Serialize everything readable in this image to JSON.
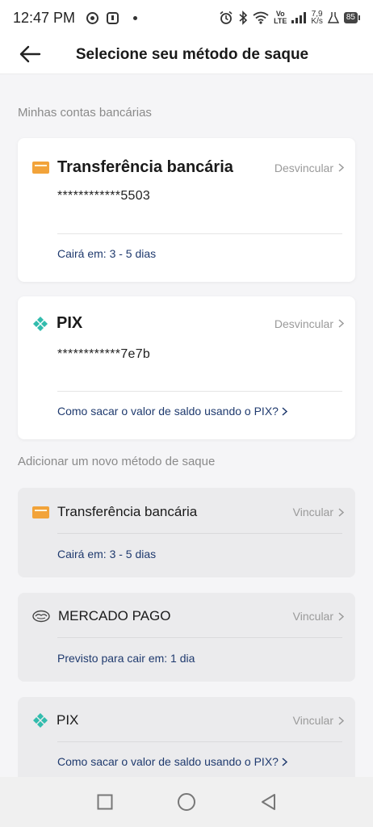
{
  "status_bar": {
    "time": "12:47 PM",
    "network_label": "Vo\nLTE",
    "speed_top": "7,9",
    "speed_bottom": "K/s",
    "battery": "85"
  },
  "header": {
    "title": "Selecione seu método de saque",
    "back_icon": "arrow-left-icon"
  },
  "linked_section": {
    "title": "Minhas contas bancárias",
    "accounts": [
      {
        "name": "Transferência bancária",
        "icon": "bank-card-icon",
        "action": "Desvincular",
        "number": "************5503",
        "info": "Cairá em: 3 - 5 dias"
      },
      {
        "name": "PIX",
        "icon": "pix-icon",
        "action": "Desvincular",
        "number": "************7e7b",
        "info": "Como sacar o valor de saldo usando o PIX?"
      }
    ]
  },
  "new_section": {
    "title": "Adicionar um novo método de saque",
    "methods": [
      {
        "name": "Transferência bancária",
        "icon": "bank-card-icon",
        "action": "Vincular",
        "info": "Cairá em: 3 - 5 dias"
      },
      {
        "name": "MERCADO PAGO",
        "icon": "mercado-pago-icon",
        "action": "Vincular",
        "info": "Previsto para cair em: 1 dia"
      },
      {
        "name": "PIX",
        "icon": "pix-icon",
        "action": "Vincular",
        "info": "Como sacar o valor de saldo usando o PIX?"
      }
    ]
  },
  "colors": {
    "link_blue": "#1f3a6e",
    "muted_gray": "#9a9a9a",
    "card_orange": "#f2a33a",
    "pix_teal": "#32bcad"
  }
}
